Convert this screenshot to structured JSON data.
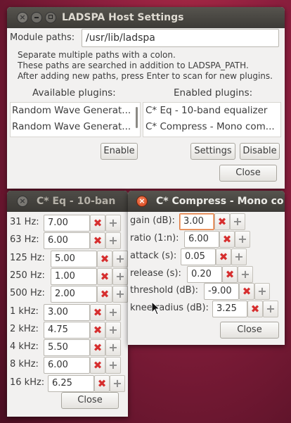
{
  "host_window": {
    "title": "LADSPA Host Settings",
    "module_paths_label": "Module paths:",
    "module_paths_value": "/usr/lib/ladspa",
    "info_lines": [
      "Separate multiple paths with a colon.",
      "These paths are searched in addition to LADSPA_PATH.",
      "After adding new paths, press Enter to scan for new plugins."
    ],
    "available_header": "Available plugins:",
    "enabled_header": "Enabled plugins:",
    "available_plugins": [
      "Random Wave Generat...",
      "Random Wave Generat..."
    ],
    "enabled_plugins": [
      "C* Eq - 10-band equalizer",
      "C* Compress - Mono com..."
    ],
    "enable_label": "Enable",
    "settings_label": "Settings",
    "disable_label": "Disable",
    "close_label": "Close"
  },
  "eq_window": {
    "title": "C* Eq - 10-ban",
    "bands": [
      {
        "label": "31 Hz:",
        "value": "7.00"
      },
      {
        "label": "63 Hz:",
        "value": "6.00"
      },
      {
        "label": "125 Hz:",
        "value": "5.00"
      },
      {
        "label": "250 Hz:",
        "value": "1.00"
      },
      {
        "label": "500 Hz:",
        "value": "2.00"
      },
      {
        "label": "1 kHz:",
        "value": "3.00"
      },
      {
        "label": "2 kHz:",
        "value": "4.75"
      },
      {
        "label": "4 kHz:",
        "value": "5.50"
      },
      {
        "label": "8 kHz:",
        "value": "6.00"
      },
      {
        "label": "16 kHz:",
        "value": "6.25"
      }
    ],
    "close_label": "Close"
  },
  "compress_window": {
    "title": "C* Compress - Mono co",
    "params": [
      {
        "label": "gain (dB):",
        "value": "3.00"
      },
      {
        "label": "ratio (1:n):",
        "value": "6.00"
      },
      {
        "label": "attack (s):",
        "value": "0.05"
      },
      {
        "label": "release (s):",
        "value": "0.20"
      },
      {
        "label": "threshold (dB):",
        "value": "-9.00"
      },
      {
        "label": "knee radius (dB):",
        "value": "3.25"
      }
    ],
    "close_label": "Close"
  },
  "icons": {
    "remove": "✖",
    "add": "+",
    "window_close": "×"
  }
}
